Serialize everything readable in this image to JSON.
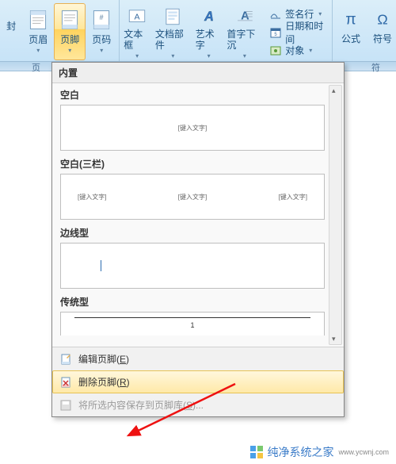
{
  "ribbon": {
    "group1_label": "页",
    "buttons": {
      "cover": "封",
      "header": "页眉",
      "footer": "页脚",
      "pagenum": "页码",
      "textbox": "文本框",
      "docparts": "文档部件",
      "wordart": "艺术字",
      "dropcap": "首字下沉"
    },
    "small": {
      "signature": "签名行",
      "datetime": "日期和时间",
      "object": "对象"
    },
    "group3_label": "符",
    "formula": "公式",
    "symbol": "符号"
  },
  "dropdown": {
    "header": "内置",
    "items": [
      {
        "title": "空白",
        "placeholder": "[键入文字]"
      },
      {
        "title": "空白(三栏)",
        "placeholder": "[键入文字]"
      },
      {
        "title": "边线型"
      },
      {
        "title": "传统型",
        "page": "1"
      }
    ],
    "footer": {
      "edit_prefix": "编辑页脚(",
      "edit_key": "E",
      "edit_suffix": ")",
      "remove_prefix": "删除页脚(",
      "remove_key": "R",
      "remove_suffix": ")",
      "save_prefix": "将所选内容保存到页脚库(",
      "save_key": "S",
      "save_suffix": ")..."
    }
  },
  "watermark": {
    "text": "纯净系统之家",
    "sub": "www.ycwnj.com"
  }
}
